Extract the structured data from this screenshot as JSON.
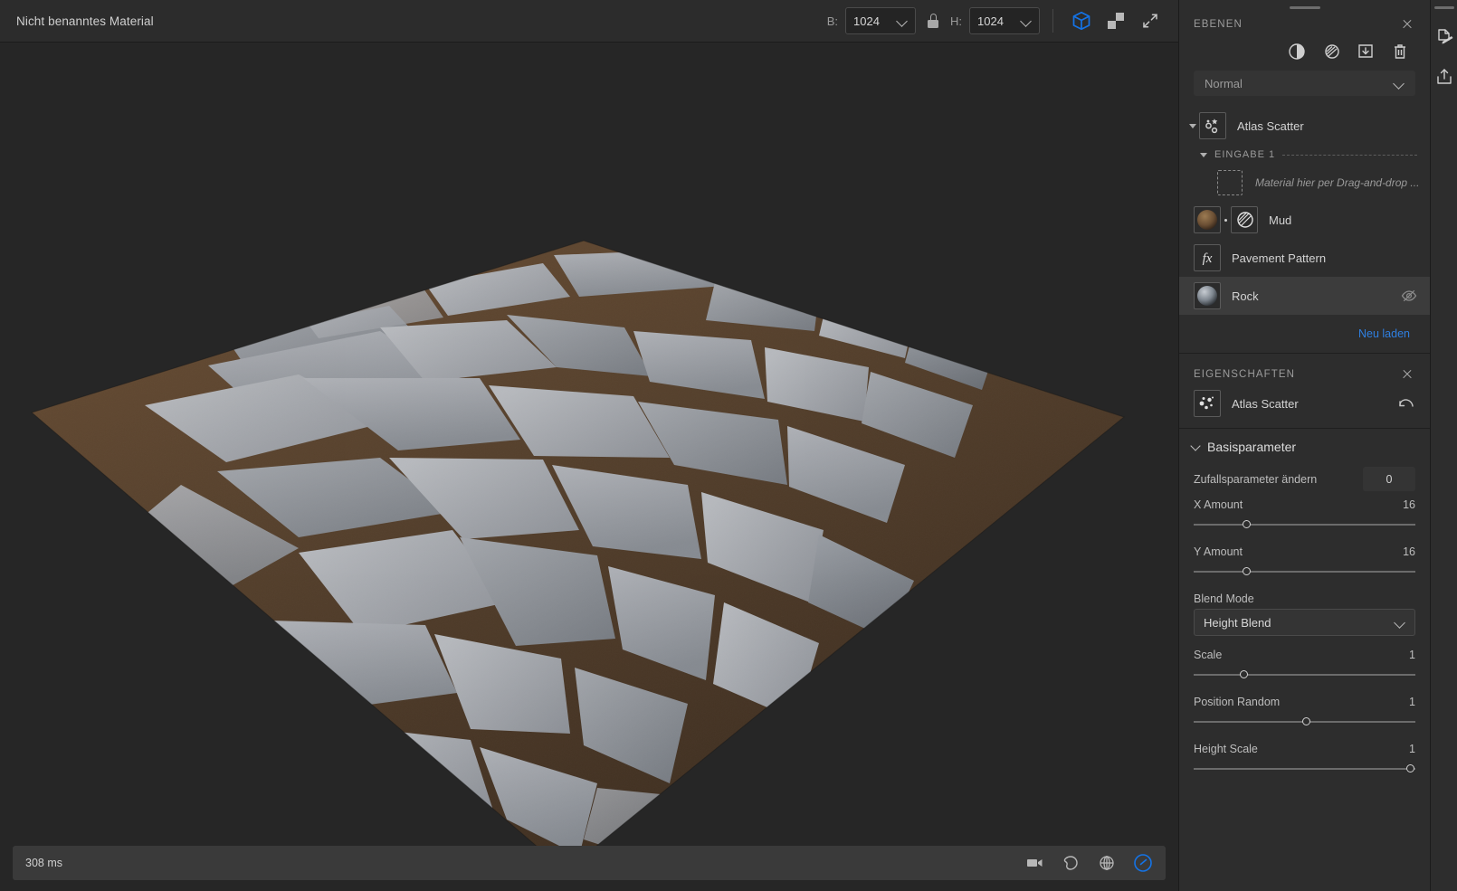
{
  "topbar": {
    "document_title": "Nicht benanntes Material",
    "width_label": "B:",
    "width_value": "1024",
    "height_label": "H:",
    "height_value": "1024",
    "lock_icon": "lock-icon",
    "view_3d_icon": "cube-3d-icon",
    "view_2d_icon": "checker-2d-icon",
    "fullscreen_icon": "expand-arrows-icon",
    "accent_color": "#1473e6"
  },
  "statusbar": {
    "render_time": "308 ms",
    "icons": [
      "video-camera-icon",
      "environment-icon",
      "globe-grid-icon",
      "render-mode-icon"
    ]
  },
  "layers": {
    "panel_title": "EBENEN",
    "close_icon": "close-icon",
    "tools": [
      "adjustment-circle-icon",
      "mask-icon",
      "import-icon",
      "trash-icon"
    ],
    "blend_mode": {
      "value": "Normal",
      "chevron_icon": "chevron-down-icon"
    },
    "root": {
      "name": "Atlas Scatter",
      "icon": "scatter-nodes-icon",
      "expanded": true,
      "selected": false
    },
    "input_group": {
      "label": "EINGABE 1",
      "expanded": true
    },
    "drop_placeholder": "Material hier per Drag-and-drop ...",
    "items": [
      {
        "name": "Mud",
        "icon": "material-sphere-mud-icon",
        "has_mask": true,
        "mask_icon": "mask-icon",
        "hidden": false,
        "selected": false
      },
      {
        "name": "Pavement Pattern",
        "icon": "fx-icon",
        "has_mask": false,
        "hidden": false,
        "selected": false
      },
      {
        "name": "Rock",
        "icon": "material-sphere-rock-icon",
        "has_mask": false,
        "hidden": true,
        "hidden_icon": "eye-off-icon",
        "selected": true
      }
    ],
    "reload_link": "Neu laden",
    "link_color": "#2f7fe0"
  },
  "properties": {
    "panel_title": "EIGENSCHAFTEN",
    "close_icon": "close-icon",
    "node_name": "Atlas Scatter",
    "node_icon": "scatter-dots-icon",
    "revert_icon": "revert-arrow-icon",
    "section": {
      "title": "Basisparameter",
      "expanded": true
    },
    "params": [
      {
        "label": "Zufallsparameter ändern",
        "type": "number",
        "value": "0"
      },
      {
        "label": "X Amount",
        "type": "slider",
        "value": "16",
        "knob_pct": 24
      },
      {
        "label": "Y Amount",
        "type": "slider",
        "value": "16",
        "knob_pct": 24
      },
      {
        "label": "Blend Mode",
        "type": "select",
        "value": "Height Blend",
        "chevron_icon": "chevron-down-icon"
      },
      {
        "label": "Scale",
        "type": "slider",
        "value": "1",
        "knob_pct": 22
      },
      {
        "label": "Position Random",
        "type": "slider",
        "value": "1",
        "knob_pct": 50
      },
      {
        "label": "Height Scale",
        "type": "slider",
        "value": "1",
        "knob_pct": 97
      }
    ]
  },
  "rail": {
    "buttons": [
      "document-edit-icon",
      "export-upload-icon"
    ]
  }
}
